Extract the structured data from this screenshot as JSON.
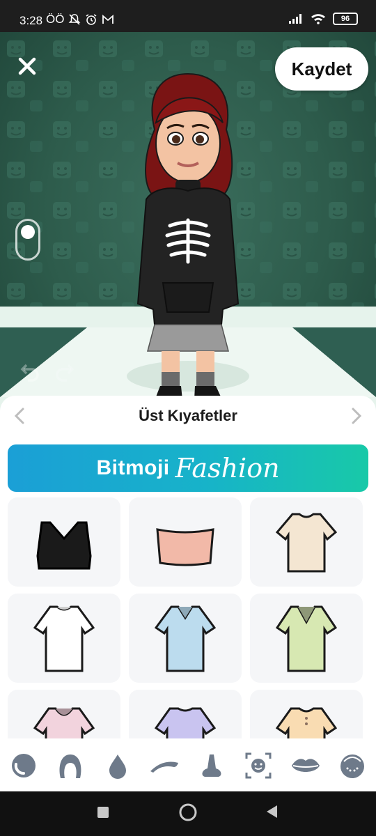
{
  "status_bar": {
    "time": "3:28",
    "indicators": "ÖÖ",
    "icons": [
      "muted-bell-icon",
      "alarm-icon",
      "gmail-icon",
      "signal-icon",
      "wifi-icon",
      "battery-icon"
    ],
    "battery": "96"
  },
  "editor": {
    "close_icon": "close-icon",
    "save_label": "Kaydet",
    "undo_icon": "undo-icon",
    "redo_icon": "redo-icon"
  },
  "category": {
    "title": "Üst Kıyafetler",
    "prev_icon": "chevron-left-icon",
    "next_icon": "chevron-right-icon"
  },
  "banner": {
    "brand": "Bitmoji",
    "fashion": "Fashion"
  },
  "items": [
    {
      "name": "black sports bra",
      "color": "#1a1a1a"
    },
    {
      "name": "pink tube top",
      "color": "#f2b9a8"
    },
    {
      "name": "beige t-shirt",
      "color": "#f4e6d2"
    },
    {
      "name": "white t-shirt",
      "color": "#ffffff"
    },
    {
      "name": "light blue v-neck tee",
      "color": "#bcdcee"
    },
    {
      "name": "light green v-neck tee",
      "color": "#d7e8b2"
    },
    {
      "name": "pink scoop tee",
      "color": "#f2d3dd"
    },
    {
      "name": "lavender tee",
      "color": "#c9c4f0"
    },
    {
      "name": "peach henley",
      "color": "#f9dcb2"
    }
  ],
  "toolbar": [
    "skin-tone-icon",
    "hair-icon",
    "hair-color-icon",
    "eyebrow-icon",
    "nose-icon",
    "face-shape-icon",
    "lips-icon",
    "face-details-icon"
  ],
  "colors": {
    "stage_green": "#2d5b4b",
    "banner_start": "#1b9fd6",
    "banner_end": "#18c9a8",
    "toolbar_icon": "#6e7a8a"
  },
  "nav": [
    "recents-square-icon",
    "home-circle-icon",
    "back-triangle-icon"
  ]
}
